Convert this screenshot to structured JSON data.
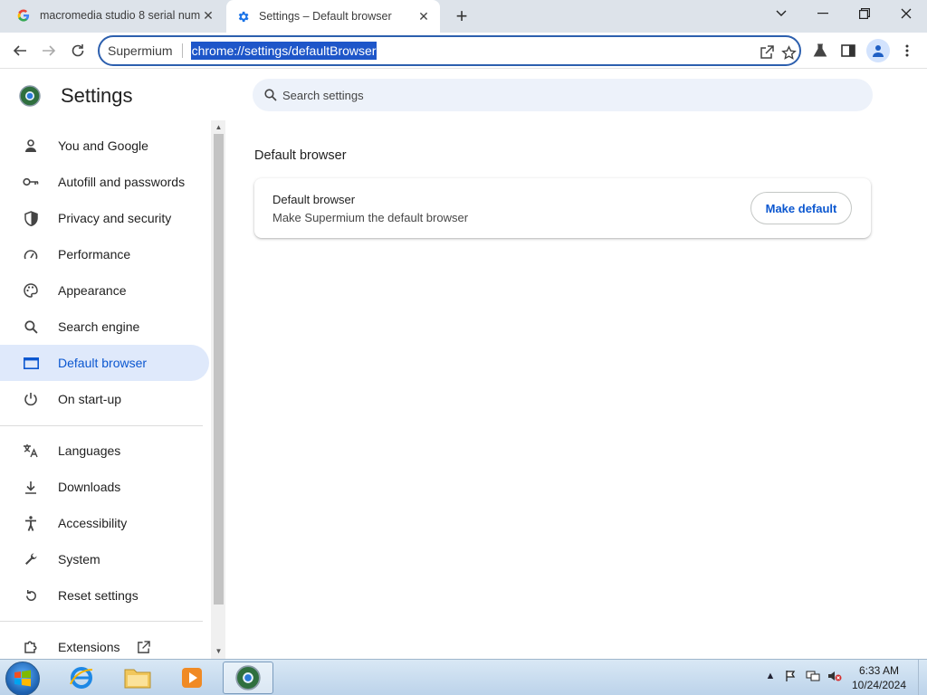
{
  "tabs": [
    {
      "title": "macromedia studio 8 serial num",
      "favicon": "google-g-icon"
    },
    {
      "title": "Settings – Default browser",
      "favicon": "gear-icon"
    }
  ],
  "omnibox": {
    "chip": "Supermium",
    "url": "chrome://settings/defaultBrowser"
  },
  "settings": {
    "title": "Settings",
    "search_placeholder": "Search settings"
  },
  "sidebar": {
    "items": [
      {
        "label": "You and Google",
        "icon": "person-icon"
      },
      {
        "label": "Autofill and passwords",
        "icon": "key-icon"
      },
      {
        "label": "Privacy and security",
        "icon": "shield-icon"
      },
      {
        "label": "Performance",
        "icon": "speedometer-icon"
      },
      {
        "label": "Appearance",
        "icon": "palette-icon"
      },
      {
        "label": "Search engine",
        "icon": "search-icon"
      },
      {
        "label": "Default browser",
        "icon": "browser-window-icon",
        "selected": true
      },
      {
        "label": "On start-up",
        "icon": "power-icon"
      },
      {
        "label": "Languages",
        "icon": "translate-icon"
      },
      {
        "label": "Downloads",
        "icon": "download-icon"
      },
      {
        "label": "Accessibility",
        "icon": "accessibility-icon"
      },
      {
        "label": "System",
        "icon": "wrench-icon"
      },
      {
        "label": "Reset settings",
        "icon": "reset-icon"
      },
      {
        "label": "Extensions",
        "icon": "puzzle-icon"
      }
    ]
  },
  "main": {
    "section_title": "Default browser",
    "card": {
      "title": "Default browser",
      "description": "Make Supermium the default browser",
      "button": "Make default"
    }
  },
  "taskbar": {
    "time": "6:33 AM",
    "date": "10/24/2024"
  },
  "colors": {
    "accent": "#0b57d0",
    "selected_bg": "#dfe9fb",
    "tabstrip_bg": "#dde3ea",
    "search_bg": "#edf2fa"
  }
}
